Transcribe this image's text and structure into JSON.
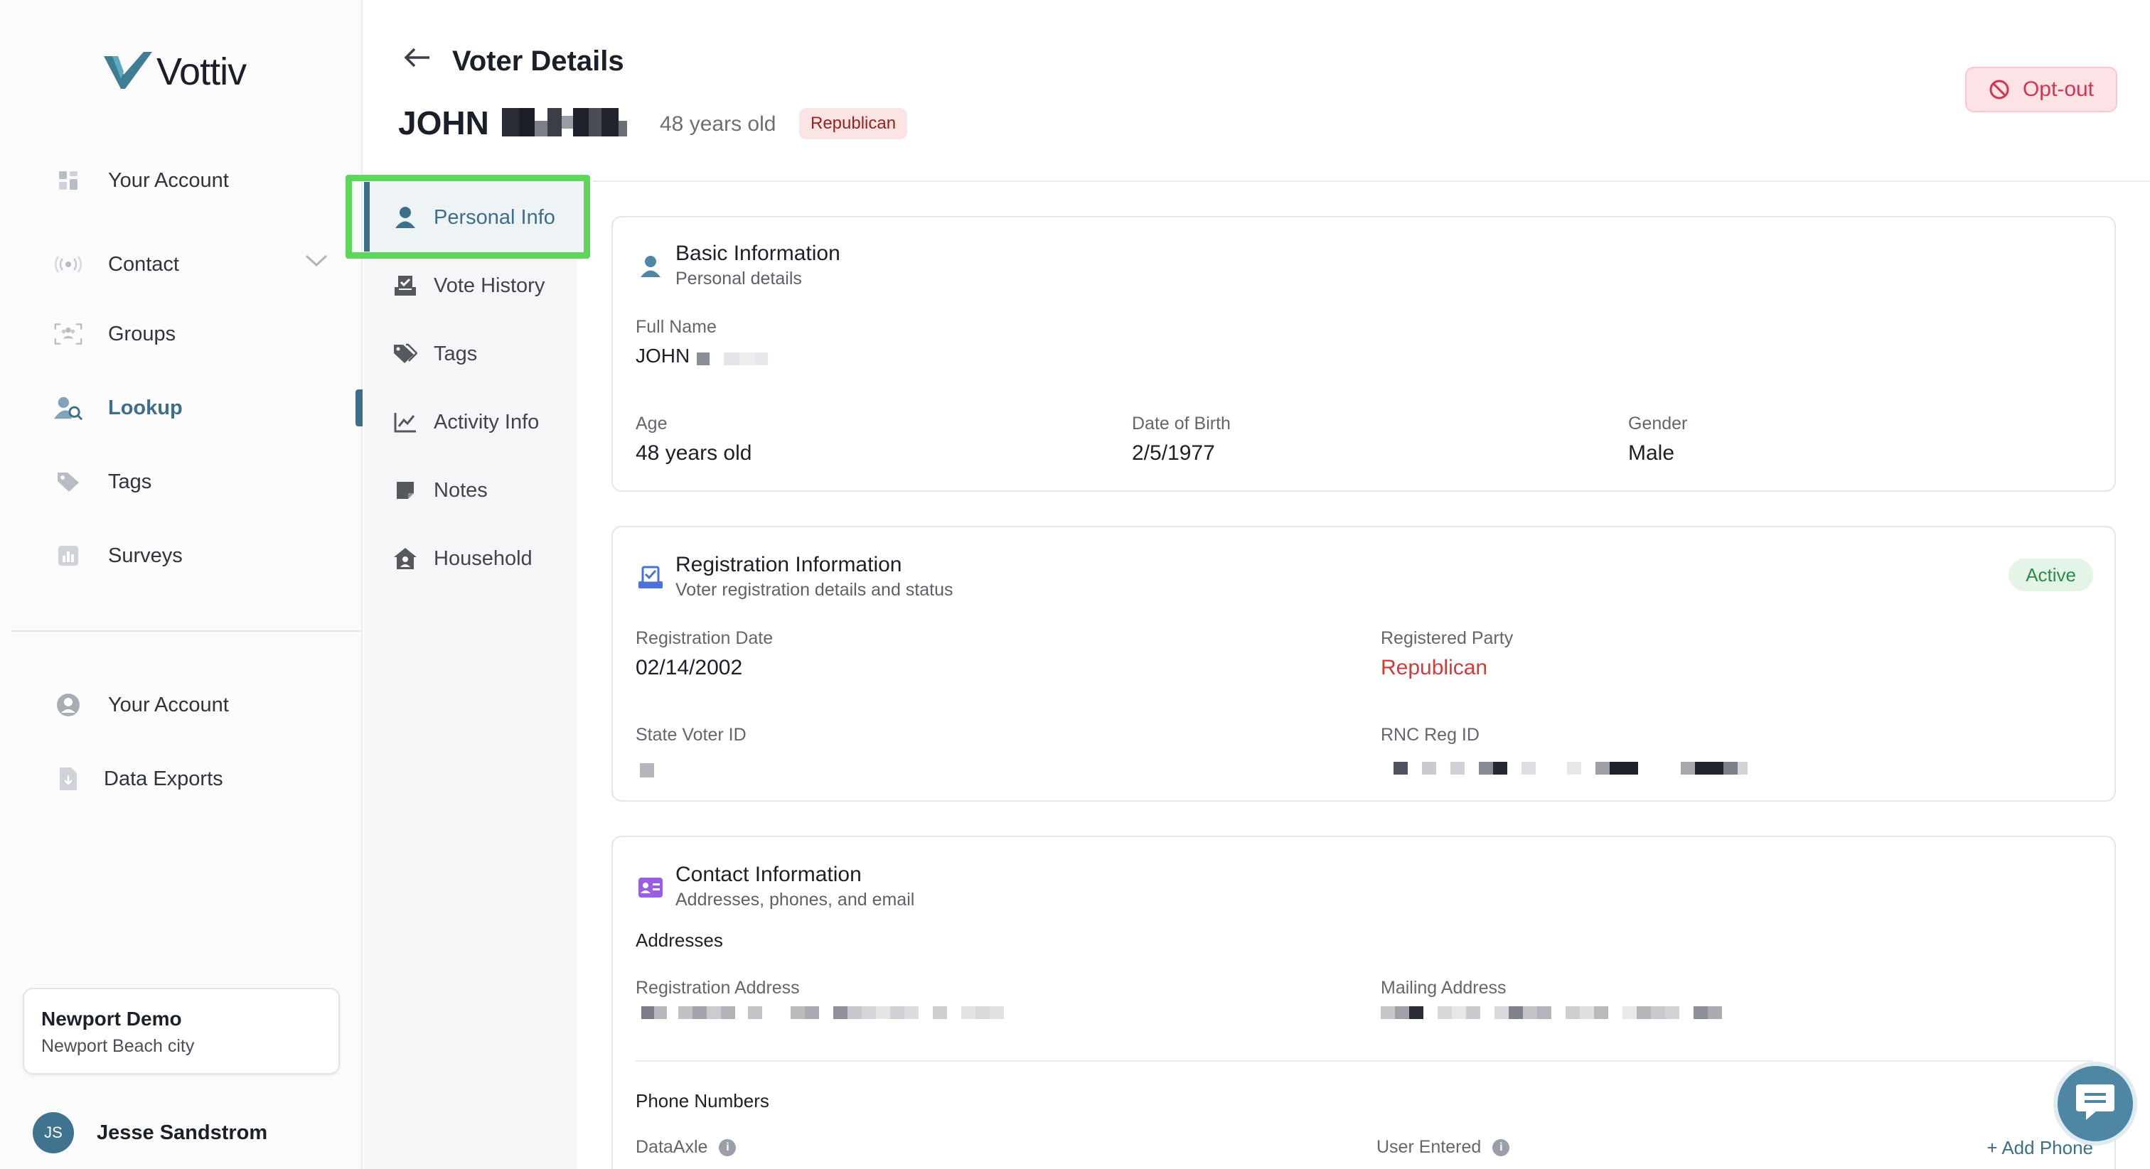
{
  "app": {
    "logo_text": "Vottiv"
  },
  "sidebar": {
    "items": [
      {
        "label": "Your Account"
      },
      {
        "label": "Contact"
      },
      {
        "label": "Groups"
      },
      {
        "label": "Lookup"
      },
      {
        "label": "Tags"
      },
      {
        "label": "Surveys"
      }
    ],
    "bottom_items": [
      {
        "label": "Your Account"
      },
      {
        "label": "Data Exports"
      }
    ],
    "org": {
      "name": "Newport Demo",
      "city": "Newport Beach city"
    },
    "user": {
      "initials": "JS",
      "name": "Jesse Sandstrom"
    }
  },
  "header": {
    "title": "Voter Details",
    "first_name": "JOHN",
    "age": "48 years old",
    "party": "Republican",
    "optout_label": "Opt-out"
  },
  "subnav": {
    "items": [
      {
        "label": "Personal Info"
      },
      {
        "label": "Vote History"
      },
      {
        "label": "Tags"
      },
      {
        "label": "Activity Info"
      },
      {
        "label": "Notes"
      },
      {
        "label": "Household"
      }
    ]
  },
  "basic": {
    "title": "Basic Information",
    "subtitle": "Personal details",
    "full_name_label": "Full Name",
    "full_name_value": "JOHN",
    "age_label": "Age",
    "age_value": "48 years old",
    "dob_label": "Date of Birth",
    "dob_value": "2/5/1977",
    "gender_label": "Gender",
    "gender_value": "Male"
  },
  "registration": {
    "title": "Registration Information",
    "subtitle": "Voter registration details and status",
    "status": "Active",
    "reg_date_label": "Registration Date",
    "reg_date_value": "02/14/2002",
    "party_label": "Registered Party",
    "party_value": "Republican",
    "state_id_label": "State Voter ID",
    "rnc_id_label": "RNC Reg ID"
  },
  "contact": {
    "title": "Contact Information",
    "subtitle": "Addresses, phones, and email",
    "addresses_label": "Addresses",
    "reg_address_label": "Registration Address",
    "mail_address_label": "Mailing Address",
    "phones_label": "Phone Numbers",
    "dataaxle_label": "DataAxle",
    "user_entered_label": "User Entered",
    "add_phone_label": "+ Add Phone"
  },
  "colors": {
    "accent": "#3d6f89",
    "highlight": "#5fd65a",
    "danger": "#d3344f",
    "success": "#2e8a47"
  },
  "icons": {
    "logo": "vottiv-check-icon",
    "back": "arrow-left-icon",
    "optout": "ban-icon",
    "chat": "chat-bubble-icon"
  }
}
